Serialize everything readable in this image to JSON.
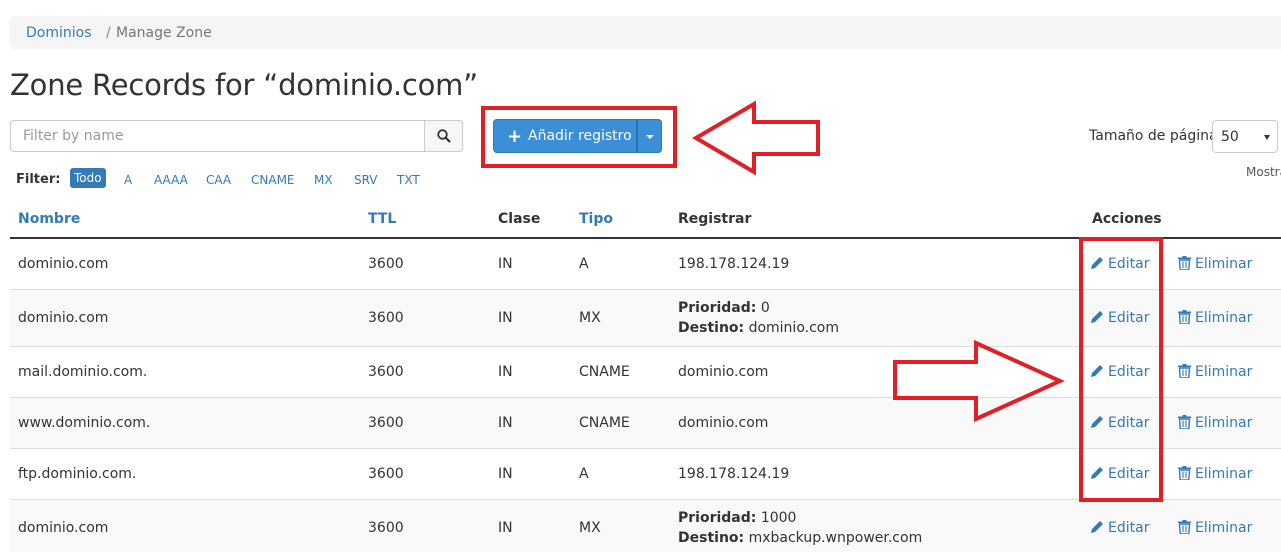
{
  "breadcrumb": {
    "root": "Dominios",
    "separator": "/",
    "current": "Manage Zone"
  },
  "page_title": "Zone Records for “dominio.com”",
  "search": {
    "placeholder": "Filter by name",
    "value": ""
  },
  "add_button": {
    "label": "Añadir registro"
  },
  "page_size": {
    "label": "Tamaño de página",
    "value": "50",
    "truncated_text": "Mostra"
  },
  "filter": {
    "label": "Filter:",
    "options": [
      "Todo",
      "A",
      "AAAA",
      "CAA",
      "CNAME",
      "MX",
      "SRV",
      "TXT"
    ],
    "active": "Todo"
  },
  "table": {
    "headers": {
      "name": "Nombre",
      "ttl": "TTL",
      "class": "Clase",
      "type": "Tipo",
      "record": "Registrar",
      "actions": "Acciones"
    },
    "rows": [
      {
        "name": "dominio.com",
        "ttl": "3600",
        "class": "IN",
        "type": "A",
        "record": "198.178.124.19"
      },
      {
        "name": "dominio.com",
        "ttl": "3600",
        "class": "IN",
        "type": "MX",
        "prio_label": "Prioridad:",
        "prio": "0",
        "dest_label": "Destino:",
        "dest": "dominio.com"
      },
      {
        "name": "mail.dominio.com.",
        "ttl": "3600",
        "class": "IN",
        "type": "CNAME",
        "record": "dominio.com"
      },
      {
        "name": "www.dominio.com.",
        "ttl": "3600",
        "class": "IN",
        "type": "CNAME",
        "record": "dominio.com"
      },
      {
        "name": "ftp.dominio.com.",
        "ttl": "3600",
        "class": "IN",
        "type": "A",
        "record": "198.178.124.19"
      },
      {
        "name": "dominio.com",
        "ttl": "3600",
        "class": "IN",
        "type": "MX",
        "prio_label": "Prioridad:",
        "prio": "1000",
        "dest_label": "Destino:",
        "dest": "mxbackup.wnpower.com"
      }
    ],
    "edit_label": "Editar",
    "delete_label": "Eliminar"
  },
  "colors": {
    "link": "#337ab7",
    "primary_button": "#3a8fd6",
    "annotation_red": "#e01f26"
  }
}
